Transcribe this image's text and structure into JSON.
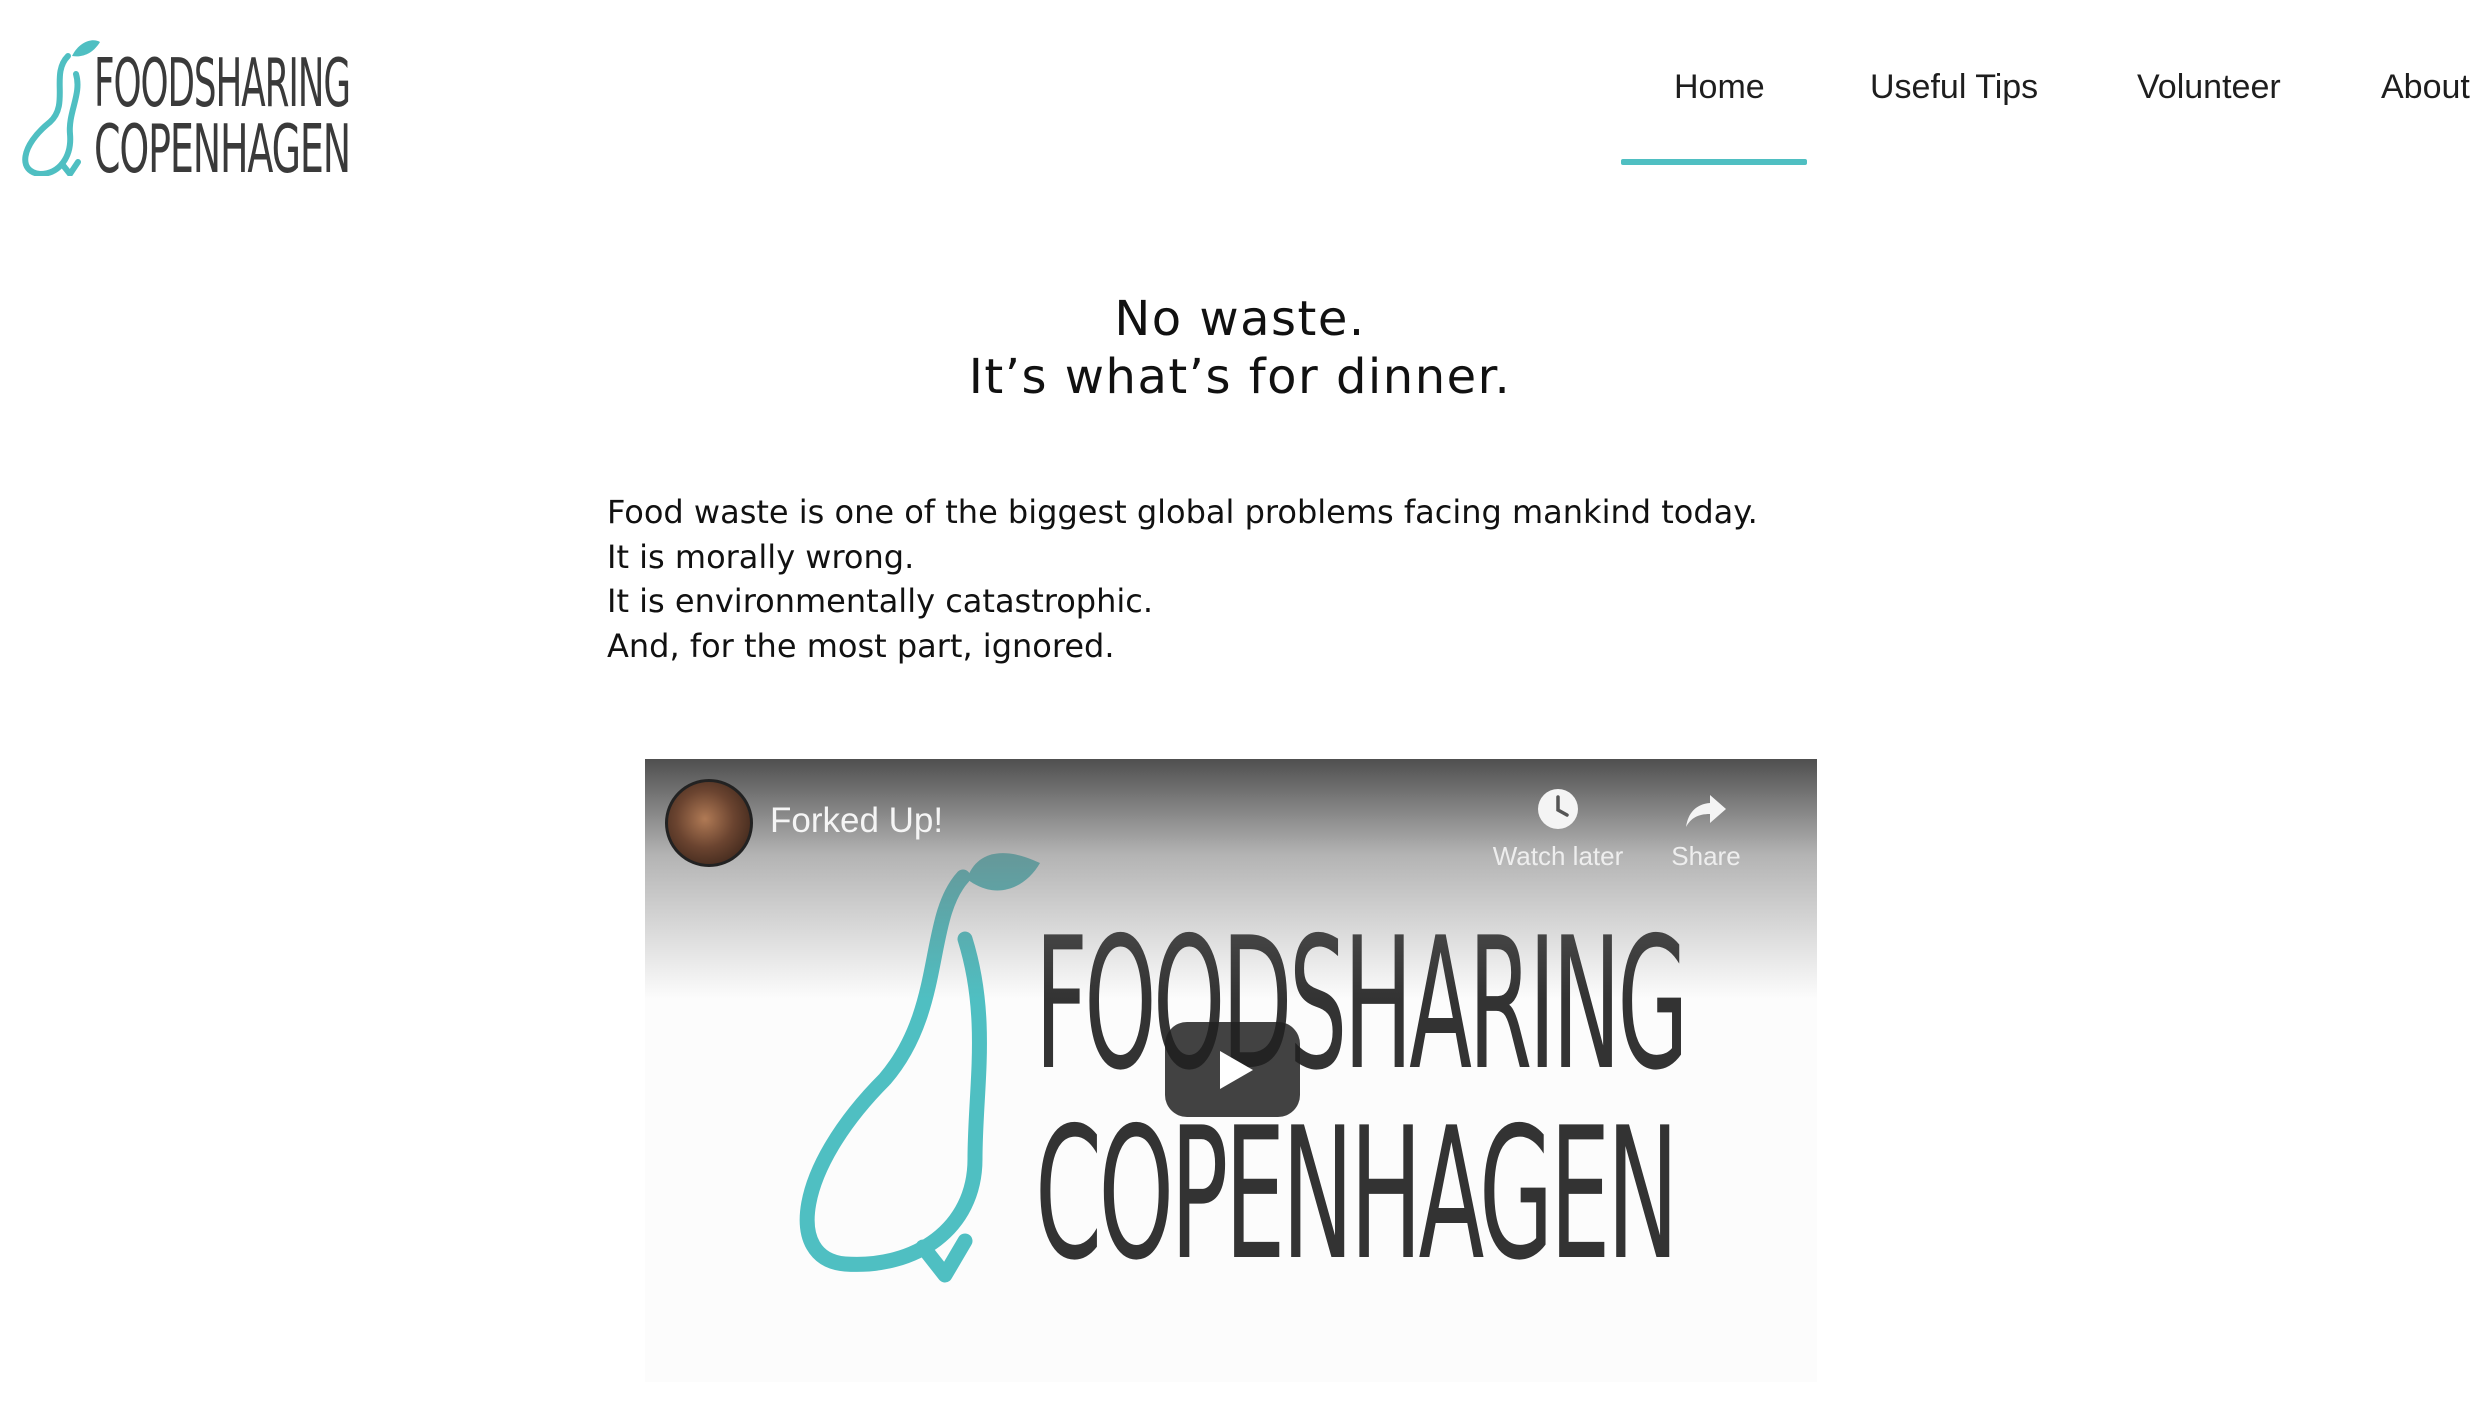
{
  "brand": {
    "logo_line1": "FOODSHARING",
    "logo_line2": "COPENHAGEN",
    "accent_color": "#4fbfc2"
  },
  "nav": {
    "items": [
      {
        "label": "Home",
        "active": true
      },
      {
        "label": "Useful Tips",
        "active": false
      },
      {
        "label": "Volunteer",
        "active": false
      },
      {
        "label": "About",
        "active": false
      }
    ]
  },
  "hero": {
    "headline_line1": "No waste.",
    "headline_line2": "It’s what’s for dinner."
  },
  "intro": {
    "lines": [
      "Food waste is one of the biggest global problems facing mankind today.",
      "It is morally wrong.",
      "It is environmentally catastrophic.",
      "And, for the most part, ignored."
    ]
  },
  "video": {
    "title": "Forked Up!",
    "watch_later_label": "Watch later",
    "share_label": "Share",
    "logo_line1": "FOODSHARING",
    "logo_line2": "COPENHAGEN",
    "icons": {
      "watch_later": "clock-icon",
      "share": "share-arrow-icon",
      "play": "play-icon"
    }
  }
}
